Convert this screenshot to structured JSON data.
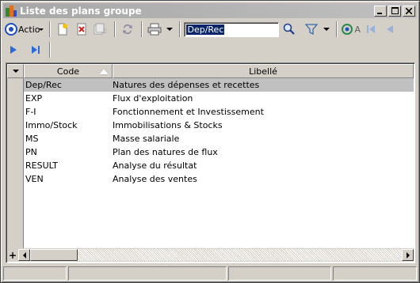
{
  "window": {
    "title": "Liste des plans groupe"
  },
  "toolbar": {
    "action_label": "Actio",
    "search_value": "Dep/Rec",
    "refresh_label": "A"
  },
  "grid": {
    "columns": [
      "Code",
      "Libellé"
    ],
    "sort_column": "Code",
    "rows": [
      {
        "code": "Dep/Rec",
        "libelle": "Natures des dépenses et recettes",
        "selected": true
      },
      {
        "code": "EXP",
        "libelle": "Flux d'exploitation"
      },
      {
        "code": "F-I",
        "libelle": "Fonctionnement et Investissement"
      },
      {
        "code": "Immo/Stock",
        "libelle": "Immobilisations & Stocks"
      },
      {
        "code": "MS",
        "libelle": "Masse salariale"
      },
      {
        "code": "PN",
        "libelle": "Plan des natures de flux"
      },
      {
        "code": "RESULT",
        "libelle": "Analyse du résultat"
      },
      {
        "code": "VEN",
        "libelle": "Analyse des ventes"
      }
    ],
    "add_label": "+"
  },
  "colors": {
    "face": "#d4d0c8",
    "selection_row": "#c0c0c0",
    "highlight": "#0a246a"
  }
}
